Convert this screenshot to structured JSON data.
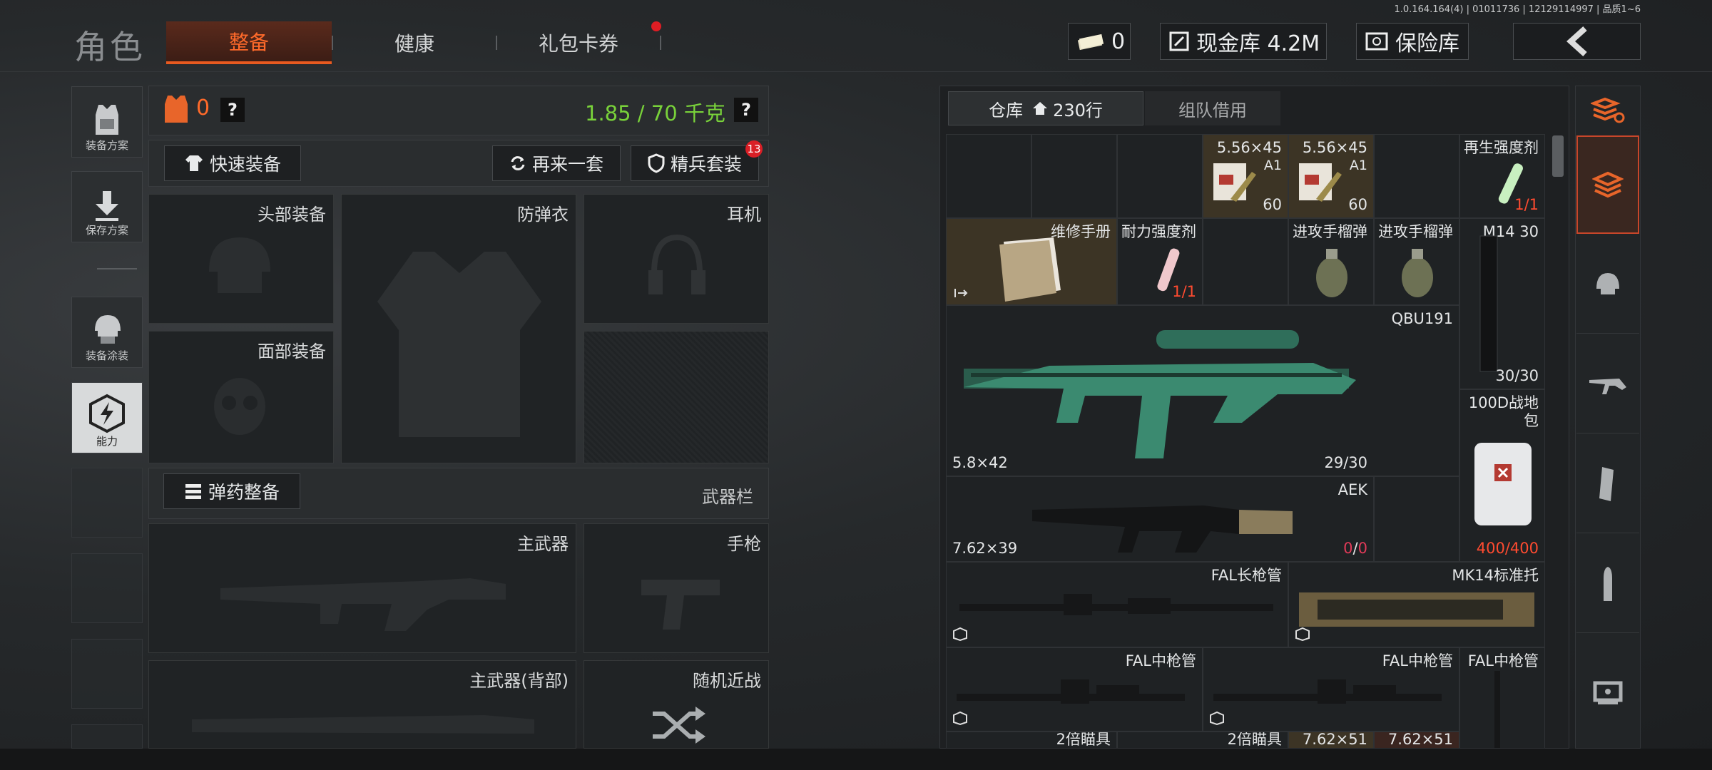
{
  "version": "1.0.164.164(4) | 01011736 | 12129114997 | 品质1~6",
  "header": {
    "role_title": "角色",
    "tabs": [
      {
        "label": "整备",
        "active": true
      },
      {
        "label": "健康",
        "active": false
      },
      {
        "label": "礼包卡券",
        "active": false,
        "has_notification": true
      }
    ],
    "cash_count": "0",
    "vault_label": "现金库 4.2M",
    "insurance_label": "保险库"
  },
  "left_rail": {
    "items": [
      {
        "label": "装备方案",
        "icon": "loadout-vest-icon"
      },
      {
        "label": "保存方案",
        "icon": "download-arrow-icon"
      },
      {
        "label": "装备涂装",
        "icon": "helmet-skin-icon"
      },
      {
        "label": "能力",
        "icon": "ability-hex-icon",
        "active": true
      }
    ]
  },
  "equip": {
    "armor_count": "0",
    "help_mark": "?",
    "weight": "1.85 / 70 千克",
    "quick_equip": "快速装备",
    "again_set": "再来一套",
    "elite_set": "精兵套装",
    "elite_badge": "13",
    "slots": {
      "head": "头部装备",
      "vest": "防弹衣",
      "headset": "耳机",
      "face": "面部装备",
      "primary": "主武器",
      "pistol": "手枪",
      "primary_back": "主武器(背部)",
      "melee": "随机近战"
    },
    "ammo_button": "弹药整备",
    "weapon_bar": "武器栏"
  },
  "warehouse": {
    "tab_storage": "仓库",
    "rows": "230行",
    "tab_team": "组队借用",
    "items": {
      "ammo1_label": "5.56×45",
      "ammo1_sub": "A1",
      "ammo1_count": "60",
      "ammo2_label": "5.56×45",
      "ammo2_sub": "A1",
      "ammo2_count": "60",
      "regen_label": "再生强度剂",
      "regen_count": "1/1",
      "manual_label": "维修手册",
      "dur_label": "耐力强度剂",
      "dur_count": "1/1",
      "grenade1_label": "进攻手榴弹",
      "grenade2_label": "进攻手榴弹",
      "mag_label": "M14 30",
      "mag_count": "30/30",
      "qbu_label": "QBU191",
      "qbu_cal": "5.8×42",
      "qbu_ammo": "29/30",
      "bag_label": "100D战地包",
      "bag_count": "400/400",
      "aek_label": "AEK",
      "aek_cal": "7.62×39",
      "aek_ammo_a": "0",
      "aek_ammo_sep": "/",
      "aek_ammo_b": "0",
      "fal_long": "FAL长枪管",
      "mk14": "MK14标准托",
      "fal_mid1": "FAL中枪管",
      "fal_mid2": "FAL中枪管",
      "fal_mid3": "FAL中枪管",
      "scope1": "2倍瞄具",
      "scope2": "2倍瞄具",
      "ammo3": "7.62×51",
      "ammo4": "7.62×51"
    }
  },
  "right_rail": {
    "icons": [
      "sort-stack-icon",
      "all-items-icon",
      "helmet-icon",
      "rifle-icon",
      "magazine-icon",
      "ammo-icon",
      "sight-icon"
    ]
  },
  "colors": {
    "accent_orange": "#ff6a2a",
    "weight_green": "#79d23a",
    "alert_red": "#e01d24"
  }
}
